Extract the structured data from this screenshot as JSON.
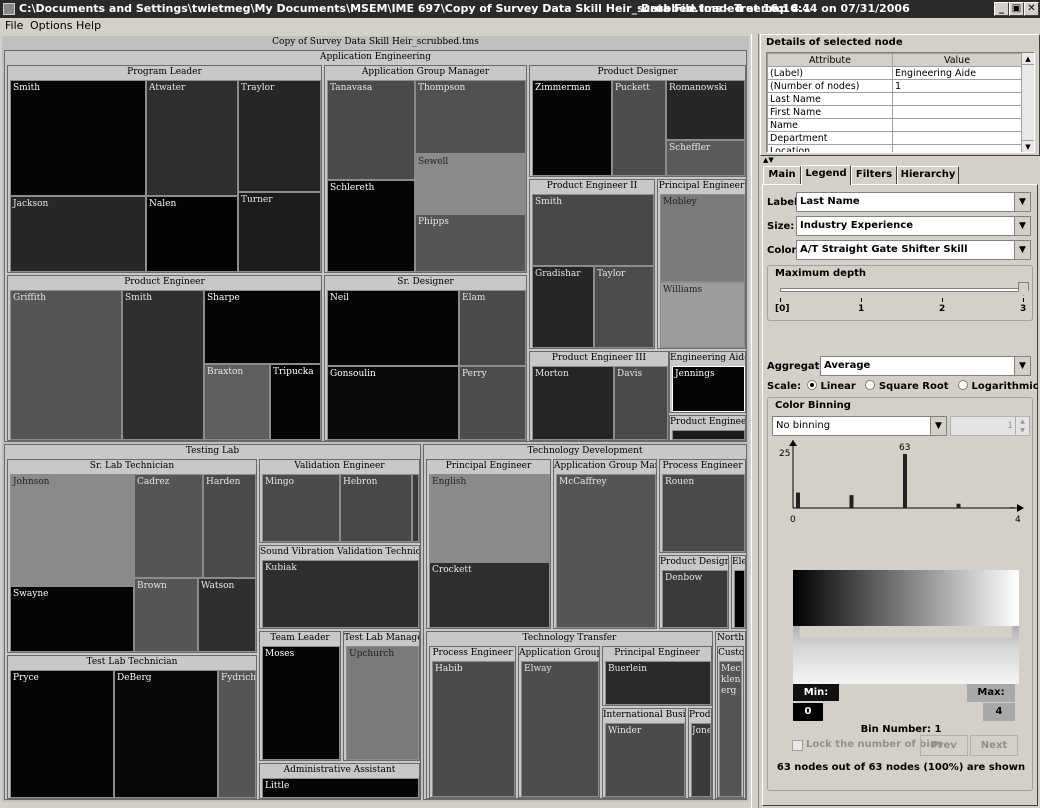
{
  "window": {
    "title": "C:\\Documents and Settings\\twietmeg\\My Documents\\MSEM\\IME 697\\Copy of Survey Data Skill Heir_scrubbed.tms - Treemap 4.1",
    "status": "Data File loaded at 16:16:44 on 07/31/2006",
    "min": "_",
    "max": "▣",
    "close": "✕"
  },
  "menu": {
    "file": "File",
    "options": "Options",
    "help": "Help"
  },
  "treemap": {
    "root": "Copy of Survey Data Skill Heir_scrubbed.tms",
    "app_eng": "Application Engineering",
    "program_leader": "Program Leader",
    "app_group_manager": "Application Group Manager",
    "product_designer": "Product Designer",
    "product_engineer": "Product Engineer",
    "sr_designer": "Sr. Designer",
    "product_engineer_ii": "Product Engineer II",
    "principal_engineer": "Principal Engineer",
    "product_engineer_iii": "Product Engineer III",
    "engineering_aide": "Engineering Aide",
    "product_engineer_i": "Product Engineer I",
    "testing_lab": "Testing Lab",
    "sr_lab_tech": "Sr. Lab Technician",
    "validation_engineer": "Validation Engineer",
    "svv_tech": "Sound Vibration Validation Technician",
    "team_leader": "Team Leader",
    "test_lab_manager": "Test Lab Manager",
    "admin_assistant": "Administrative Assistant",
    "test_lab_tech": "Test Lab Technician",
    "tech_dev": "Technology Development",
    "td_principal": "Principal Engineer",
    "td_app_group": "Application Group Mana",
    "td_process": "Process Engineer",
    "td_prod_designer": "Product Designer",
    "td_ele": "Ele",
    "tech_transfer": "Technology Transfer",
    "tt_process": "Process Engineer",
    "tt_app_group": "Application Group",
    "tt_principal": "Principal Engineer",
    "tt_intl": "International Busines",
    "tt_produ": "Produ",
    "north": "North",
    "custo": "Custo",
    "names": {
      "smith": "Smith",
      "atwater": "Atwater",
      "traylor": "Traylor",
      "jackson": "Jackson",
      "nalen": "Nalen",
      "turner": "Turner",
      "tanavasa": "Tanavasa",
      "thompson": "Thompson",
      "sewell": "Sewell",
      "schlereth": "Schlereth",
      "phipps": "Phipps",
      "zimmerman": "Zimmerman",
      "puckett": "Puckett",
      "romanowski": "Romanowski",
      "scheffler": "Scheffler",
      "griffith": "Griffith",
      "smith2": "Smith",
      "sharpe": "Sharpe",
      "braxton": "Braxton",
      "tripucka": "Tripucka",
      "neil": "Neil",
      "elam": "Elam",
      "gonsoulin": "Gonsoulin",
      "perry": "Perry",
      "smith3": "Smith",
      "gradishar": "Gradishar",
      "taylor": "Taylor",
      "mobley": "Mobley",
      "williams": "Williams",
      "morton": "Morton",
      "davis": "Davis",
      "jennings": "Jennings",
      "johnson": "Johnson",
      "cadrez": "Cadrez",
      "harden": "Harden",
      "swayne": "Swayne",
      "brown": "Brown",
      "watson": "Watson",
      "mingo": "Mingo",
      "hebron": "Hebron",
      "kubiak": "Kubiak",
      "moses": "Moses",
      "upchurch": "Upchurch",
      "little": "Little",
      "pryce": "Pryce",
      "deberg": "DeBerg",
      "fydrich": "Fydrich",
      "english": "English",
      "crockett": "Crockett",
      "mccaffrey": "McCaffrey",
      "rouen": "Rouen",
      "denbow": "Denbow",
      "habib": "Habib",
      "elway": "Elway",
      "buerlein": "Buerlein",
      "winder": "Winder",
      "jone": "Jone",
      "mec": "Mec",
      "klenb": "klenb",
      "erg": "erg"
    }
  },
  "details": {
    "title": "Details of selected node",
    "col_attr": "Attribute",
    "col_val": "Value",
    "rows": [
      [
        "(Label)",
        "Engineering Aide"
      ],
      [
        "(Number of nodes)",
        "1"
      ],
      [
        "Last Name",
        ""
      ],
      [
        "First Name",
        ""
      ],
      [
        "Name",
        ""
      ],
      [
        "Department",
        ""
      ],
      [
        "Location",
        ""
      ]
    ]
  },
  "tabs": {
    "main": "Main",
    "legend": "Legend",
    "filters": "Filters",
    "hierarchy": "Hierarchy"
  },
  "legend": {
    "label_lbl": "Label:",
    "label_val": "Last Name",
    "size_lbl": "Size:",
    "size_val": "Industry Experience",
    "color_lbl": "Color:",
    "color_val": "A/T Straight Gate Shifter Skill",
    "maxdepth": "Maximum depth",
    "ticks": [
      "[0]",
      "1",
      "2",
      "3"
    ],
    "depth_value": 3,
    "aggregate_lbl": "Aggregate:",
    "aggregate_val": "Average",
    "scale_lbl": "Scale:",
    "scale_opts": [
      "Linear",
      "Square Root",
      "Logarithmic"
    ],
    "scale_selected": "Linear",
    "binning": "Color Binning",
    "binning_val": "No binning",
    "bins_field": "1",
    "hist_ymax_label": "25",
    "hist_peak_label": "63",
    "hist_xmin": "0",
    "hist_xmax": "4",
    "min_lbl": "Min:",
    "min_val": "0",
    "max_lbl": "Max:",
    "max_val": "4",
    "bin_number": "Bin Number: 1",
    "lock_label": "Lock the number of bins",
    "prev": "Prev",
    "next": "Next",
    "summary": "63  nodes out of  63 nodes  (100%) are shown"
  },
  "chart_data": {
    "type": "bar",
    "x": [
      0,
      1,
      2,
      3,
      4
    ],
    "values": [
      18,
      15,
      63,
      5,
      1
    ],
    "ylabel": "",
    "xlabel": "",
    "xlim": [
      0,
      4
    ]
  }
}
